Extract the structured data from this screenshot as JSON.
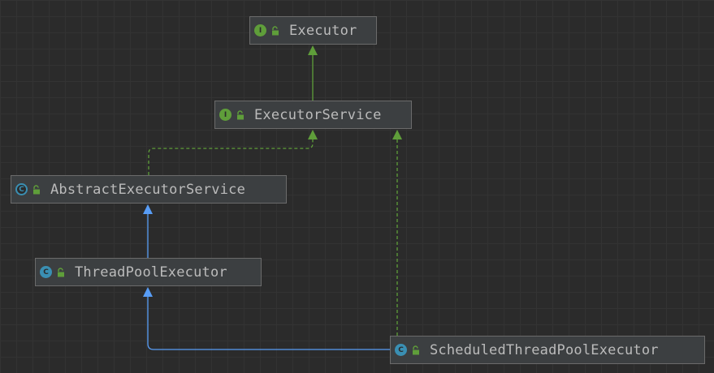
{
  "diagram": {
    "colors": {
      "background": "#2b2b2b",
      "node_fill": "#3c3f41",
      "interface_badge": "#5f9e3a",
      "class_badge": "#3a8fb3",
      "realization_edge": "#5f9e3a",
      "inheritance_edge": "#589df6"
    },
    "nodes": [
      {
        "id": "executor",
        "kind": "interface",
        "badge": "I",
        "name": "Executor",
        "icon": "interface-icon"
      },
      {
        "id": "executor-service",
        "kind": "interface",
        "badge": "I",
        "name": "ExecutorService",
        "icon": "interface-icon"
      },
      {
        "id": "abstract-executor-service",
        "kind": "abstract-class",
        "badge": "C",
        "name": "AbstractExecutorService",
        "icon": "abstract-class-icon"
      },
      {
        "id": "thread-pool-executor",
        "kind": "class",
        "badge": "C",
        "name": "ThreadPoolExecutor",
        "icon": "class-icon"
      },
      {
        "id": "scheduled-thread-pool-executor",
        "kind": "class",
        "badge": "C",
        "name": "ScheduledThreadPoolExecutor",
        "icon": "class-icon"
      }
    ],
    "edges": [
      {
        "from": "executor-service",
        "to": "executor",
        "type": "extends-interface"
      },
      {
        "from": "abstract-executor-service",
        "to": "executor-service",
        "type": "implements"
      },
      {
        "from": "thread-pool-executor",
        "to": "abstract-executor-service",
        "type": "extends"
      },
      {
        "from": "scheduled-thread-pool-executor",
        "to": "thread-pool-executor",
        "type": "extends"
      },
      {
        "from": "scheduled-thread-pool-executor",
        "to": "executor-service",
        "type": "implements"
      }
    ]
  }
}
